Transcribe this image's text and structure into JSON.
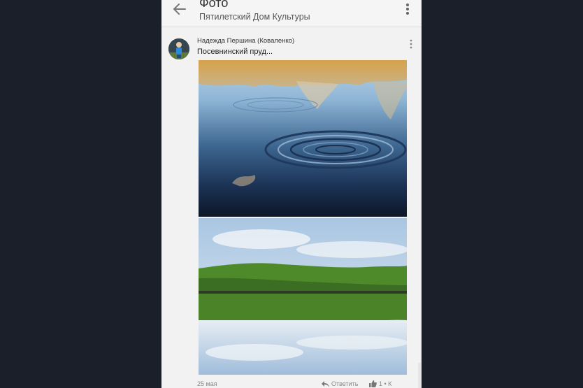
{
  "appbar": {
    "title": "Фото",
    "subtitle": "Пятилетский Дом Культуры",
    "back_icon": "arrow-left-icon",
    "more_icon": "more-vertical-icon"
  },
  "post": {
    "author": "Надежда Першина (Коваленко)",
    "text": "Посевнинский пруд...",
    "date": "25 мая",
    "reply_label": "Ответить",
    "like_label": "1 • К"
  },
  "colors": {
    "page_background": "#1b1f2a",
    "card_background": "#f2f2f2",
    "text_primary": "#222222",
    "text_secondary": "#888888"
  }
}
